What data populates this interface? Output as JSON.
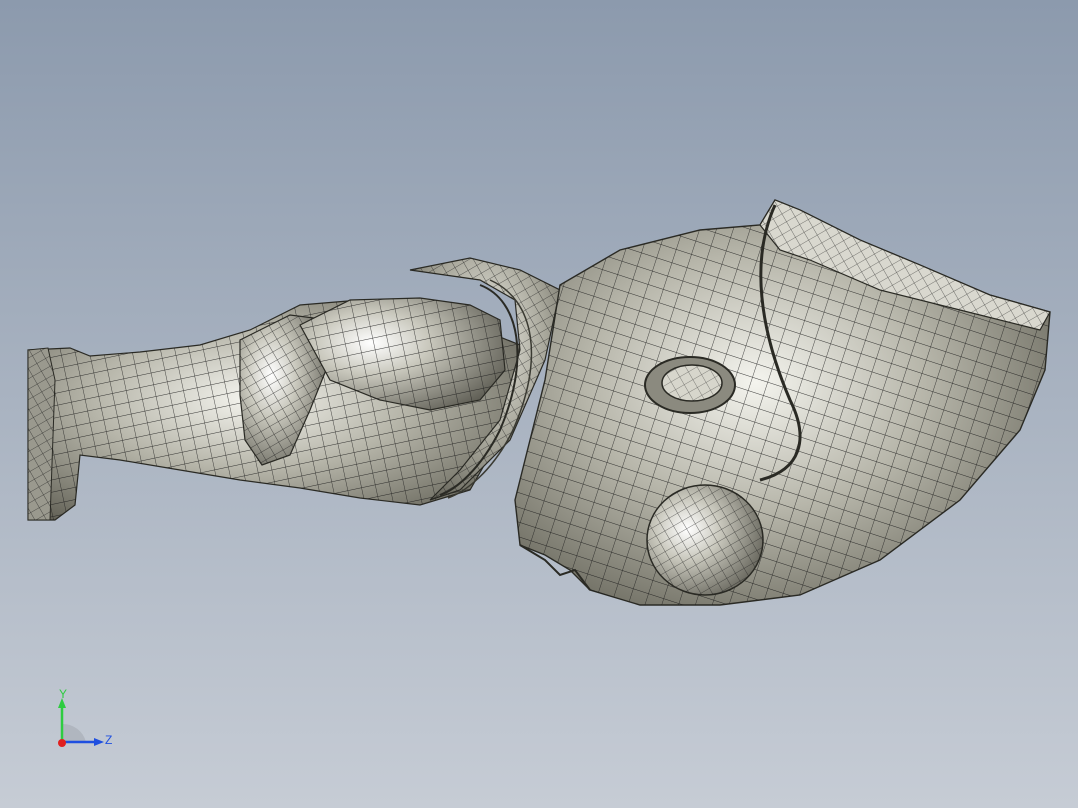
{
  "viewport": {
    "background_top": "#8c9aad",
    "background_bottom": "#c3c9d2",
    "model_fill": "#b8b8ad",
    "mesh_line": "#1a1a1a"
  },
  "triad": {
    "y_label": "Y",
    "z_label": "Z",
    "y_color": "#2ecc40",
    "z_color": "#1f4fe0",
    "x_color": "#e02020"
  }
}
